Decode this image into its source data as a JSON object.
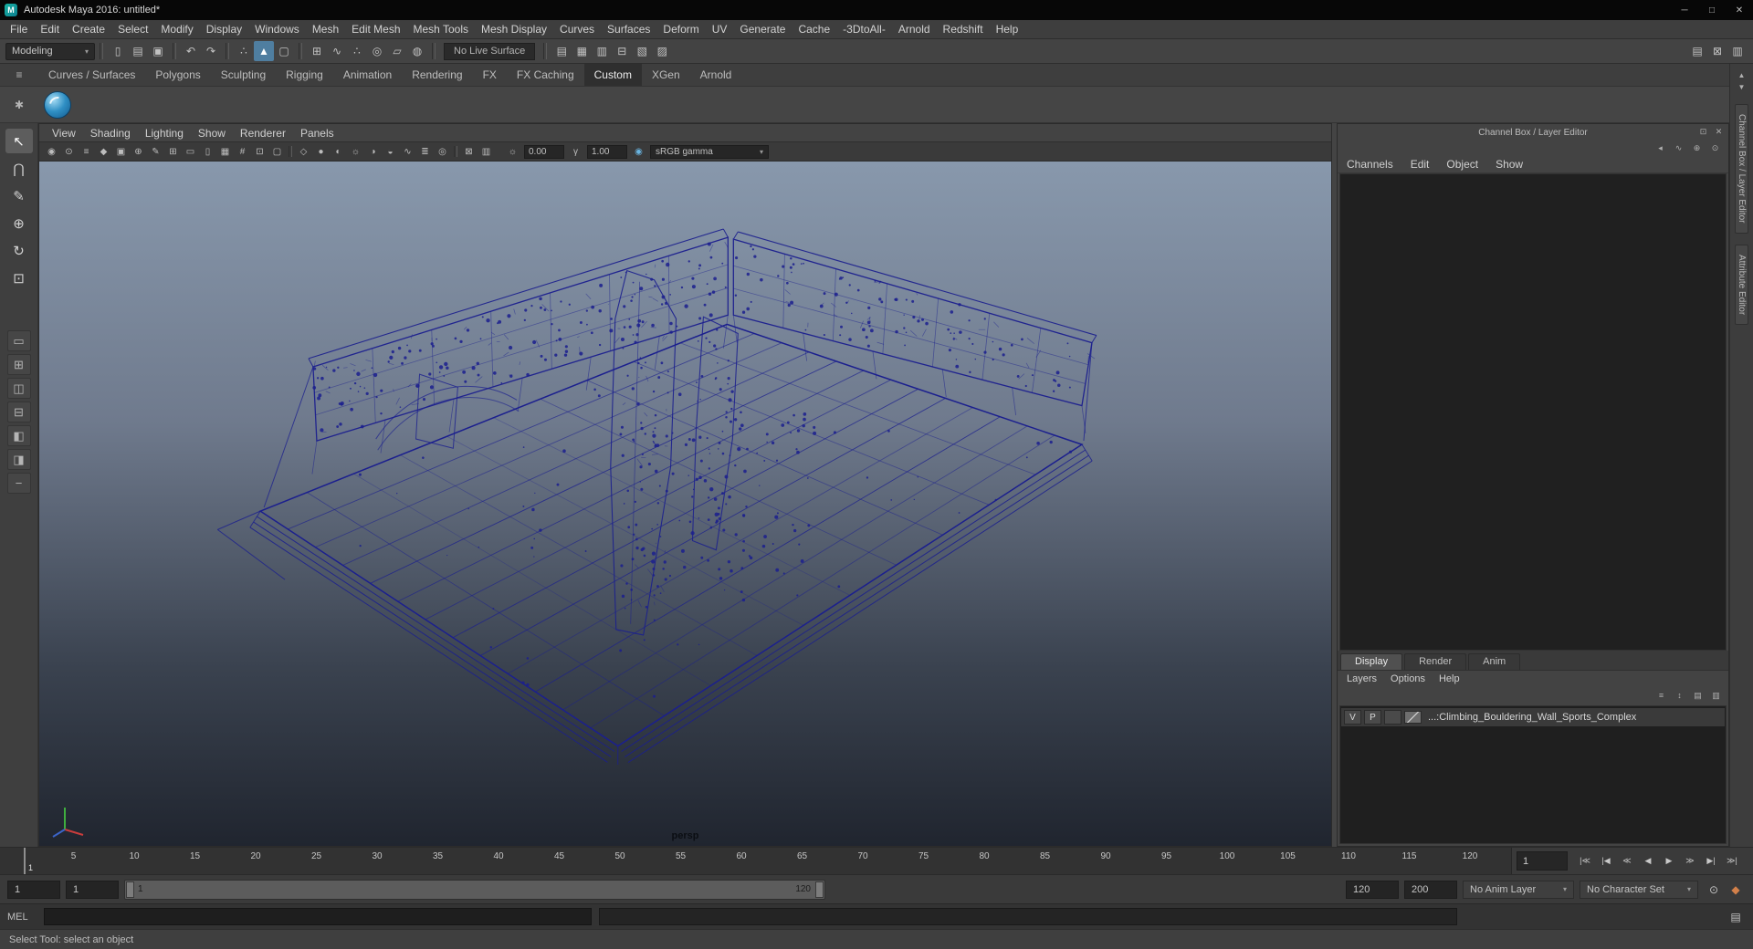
{
  "ui": {
    "chevron_down": "▾",
    "hamburger": "≡",
    "gear": "✱"
  },
  "colors": {
    "accent_blue": "#4f7ea0",
    "wireframe": "#1b1f8e",
    "viewport_top": "#8898ac",
    "viewport_bottom": "#20252f"
  },
  "titlebar": {
    "icon": "M",
    "title": "Autodesk Maya 2016: untitled*",
    "controls": [
      {
        "name": "minimize-button",
        "glyph": "─"
      },
      {
        "name": "maximize-button",
        "glyph": "□"
      },
      {
        "name": "close-button",
        "glyph": "✕"
      }
    ]
  },
  "menubar": {
    "items": [
      "File",
      "Edit",
      "Create",
      "Select",
      "Modify",
      "Display",
      "Windows",
      "Mesh",
      "Edit Mesh",
      "Mesh Tools",
      "Mesh Display",
      "Curves",
      "Surfaces",
      "Deform",
      "UV",
      "Generate",
      "Cache",
      "-3DtoAll-",
      "Arnold",
      "Redshift",
      "Help"
    ]
  },
  "statusline": {
    "menuset": "Modeling",
    "groups": [
      {
        "name": "scene",
        "icons": [
          {
            "name": "new-scene-icon",
            "glyph": "▯"
          },
          {
            "name": "open-scene-icon",
            "glyph": "▤"
          },
          {
            "name": "save-scene-icon",
            "glyph": "▣"
          }
        ]
      },
      {
        "name": "undo-redo",
        "icons": [
          {
            "name": "undo-icon",
            "glyph": "↶"
          },
          {
            "name": "redo-icon",
            "glyph": "↷"
          }
        ]
      },
      {
        "name": "selection-mode",
        "icons": [
          {
            "name": "select-hierarchy-icon",
            "glyph": "∴"
          },
          {
            "name": "select-object-icon",
            "glyph": "▲",
            "active": true
          },
          {
            "name": "select-component-icon",
            "glyph": "▢"
          }
        ]
      },
      {
        "name": "snapping",
        "icons": [
          {
            "name": "snap-to-grid-icon",
            "glyph": "⊞"
          },
          {
            "name": "snap-to-curves-icon",
            "glyph": "∿"
          },
          {
            "name": "snap-to-points-icon",
            "glyph": "∴"
          },
          {
            "name": "snap-to-projected-center-icon",
            "glyph": "◎"
          },
          {
            "name": "snap-to-view-planes-icon",
            "glyph": "▱"
          },
          {
            "name": "make-live-icon",
            "glyph": "◍"
          }
        ]
      }
    ],
    "live_surface": "No Live Surface",
    "render_group": [
      {
        "name": "render-view-icon",
        "glyph": "▤"
      },
      {
        "name": "render-current-frame-icon",
        "glyph": "▦"
      },
      {
        "name": "ipr-render-icon",
        "glyph": "▥"
      },
      {
        "name": "render-settings-icon",
        "glyph": "⊟"
      },
      {
        "name": "hypershade-icon",
        "glyph": "▧"
      },
      {
        "name": "light-editor-icon",
        "glyph": "▨"
      }
    ],
    "right_icons": [
      {
        "name": "sidebar-attribute-editor-icon",
        "glyph": "▤"
      },
      {
        "name": "sidebar-tool-settings-icon",
        "glyph": "⊠"
      },
      {
        "name": "sidebar-channel-box-icon",
        "glyph": "▥"
      }
    ]
  },
  "shelf": {
    "tabs": [
      "Curves / Surfaces",
      "Polygons",
      "Sculpting",
      "Rigging",
      "Animation",
      "Rendering",
      "FX",
      "FX Caching",
      "Custom",
      "XGen",
      "Arnold"
    ],
    "active_tab": "Custom"
  },
  "toolbox": {
    "tools": [
      {
        "name": "select-tool",
        "glyph": "↖"
      },
      {
        "name": "lasso-tool",
        "glyph": "⋂"
      },
      {
        "name": "paint-select-tool",
        "glyph": "✎"
      },
      {
        "name": "move-tool",
        "glyph": "⊕"
      },
      {
        "name": "rotate-tool",
        "glyph": "↻"
      },
      {
        "name": "scale-tool",
        "glyph": "⊡"
      }
    ],
    "layouts": [
      {
        "name": "single-pane-layout",
        "glyph": "▭"
      },
      {
        "name": "four-pane-layout",
        "glyph": "⊞"
      },
      {
        "name": "side-by-side-layout",
        "glyph": "◫"
      },
      {
        "name": "stacked-layout",
        "glyph": "⊟"
      },
      {
        "name": "three-pane-left-layout",
        "glyph": "◧"
      },
      {
        "name": "outliner-persp-layout",
        "glyph": "◨"
      }
    ],
    "collapse": "−"
  },
  "panel_menu": {
    "items": [
      "View",
      "Shading",
      "Lighting",
      "Show",
      "Renderer",
      "Panels"
    ]
  },
  "viewport_toolbar": {
    "groups": [
      [
        {
          "name": "select-camera-icon",
          "glyph": "◉"
        },
        {
          "name": "lock-camera-icon",
          "glyph": "⊙"
        },
        {
          "name": "camera-attributes-icon",
          "glyph": "≡"
        },
        {
          "name": "bookmarks-icon",
          "glyph": "◆"
        },
        {
          "name": "image-plane-icon",
          "glyph": "▣"
        },
        {
          "name": "two-d-pan-zoom-icon",
          "glyph": "⊕"
        },
        {
          "name": "grease-pencil-icon",
          "glyph": "✎"
        },
        {
          "name": "grid-icon",
          "glyph": "⊞"
        },
        {
          "name": "film-gate-icon",
          "glyph": "▭"
        },
        {
          "name": "resolution-gate-icon",
          "glyph": "▯"
        },
        {
          "name": "gate-mask-icon",
          "glyph": "▦"
        },
        {
          "name": "field-chart-icon",
          "glyph": "#"
        },
        {
          "name": "safe-action-icon",
          "glyph": "⊡"
        },
        {
          "name": "safe-title-icon",
          "glyph": "▢"
        }
      ],
      [
        {
          "name": "wireframe-icon",
          "glyph": "◇"
        },
        {
          "name": "smooth-shade-icon",
          "glyph": "●"
        },
        {
          "name": "textured-icon",
          "glyph": "◐"
        },
        {
          "name": "use-all-lights-icon",
          "glyph": "☼"
        },
        {
          "name": "shadows-icon",
          "glyph": "◑"
        },
        {
          "name": "screen-space-ao-icon",
          "glyph": "◒"
        },
        {
          "name": "motion-blur-icon",
          "glyph": "∿"
        },
        {
          "name": "multisampling-icon",
          "glyph": "≣"
        },
        {
          "name": "depth-of-field-icon",
          "glyph": "◎"
        }
      ],
      [
        {
          "name": "isolate-select-icon",
          "glyph": "⊠"
        },
        {
          "name": "x-ray-icon",
          "glyph": "▥"
        }
      ]
    ],
    "exposure_icon": {
      "glyph": "☼"
    },
    "exposure": "0.00",
    "gamma_icon": {
      "glyph": "γ"
    },
    "gamma": "1.00",
    "color_mgmt_icon": {
      "glyph": "◉"
    },
    "view_transform": "sRGB gamma"
  },
  "viewport": {
    "camera_label": "persp"
  },
  "channel_box": {
    "header": "Channel Box / Layer Editor",
    "header_icons": [
      {
        "name": "dock-icon",
        "glyph": "⊡"
      },
      {
        "name": "close-icon",
        "glyph": "✕"
      }
    ],
    "toolbar_icons": [
      {
        "name": "collapse-left-icon",
        "glyph": "◂"
      },
      {
        "name": "slider-speed-icon",
        "glyph": "∿"
      },
      {
        "name": "manipulator-icon",
        "glyph": "⊕"
      },
      {
        "name": "channel-settings-icon",
        "glyph": "⊙"
      }
    ],
    "menu": [
      "Channels",
      "Edit",
      "Object",
      "Show"
    ]
  },
  "layer_editor": {
    "tabs": [
      {
        "label": "Display",
        "active": true
      },
      {
        "label": "Render",
        "active": false
      },
      {
        "label": "Anim",
        "active": false
      }
    ],
    "menu": [
      "Layers",
      "Options",
      "Help"
    ],
    "toolbar_icons": [
      {
        "name": "sort-layers-icon",
        "glyph": "≡"
      },
      {
        "name": "move-layer-icon",
        "glyph": "↕"
      },
      {
        "name": "new-empty-layer-icon",
        "glyph": "▤"
      },
      {
        "name": "new-layer-from-selected-icon",
        "glyph": "▥"
      }
    ],
    "layer": {
      "visibility": "V",
      "playback": "P",
      "name": "...:Climbing_Bouldering_Wall_Sports_Complex"
    }
  },
  "side_tabs": {
    "scroll_up": "▲",
    "scroll_down": "▼",
    "tabs": [
      "Channel Box / Layer Editor",
      "Attribute Editor"
    ]
  },
  "timeline": {
    "ticks": [
      "5",
      "10",
      "15",
      "20",
      "25",
      "30",
      "35",
      "40",
      "45",
      "50",
      "55",
      "60",
      "65",
      "70",
      "75",
      "80",
      "85",
      "90",
      "95",
      "100",
      "105",
      "110",
      "115",
      "120"
    ],
    "marker_label": "1"
  },
  "playback": {
    "current_frame": "1",
    "buttons": [
      {
        "name": "go-to-start-button",
        "glyph": "|≪"
      },
      {
        "name": "step-back-frame-button",
        "glyph": "|◀"
      },
      {
        "name": "step-back-key-button",
        "glyph": "≪"
      },
      {
        "name": "play-backwards-button",
        "glyph": "◀"
      },
      {
        "name": "play-forwards-button",
        "glyph": "▶"
      },
      {
        "name": "step-forward-key-button",
        "glyph": "≫"
      },
      {
        "name": "step-forward-frame-button",
        "glyph": "▶|"
      },
      {
        "name": "go-to-end-button",
        "glyph": "≫|"
      }
    ]
  },
  "range_slider": {
    "anim_start": "1",
    "playback_start": "1",
    "bar_start": "1",
    "bar_end": "120",
    "playback_end": "120",
    "anim_end": "200",
    "anim_layer": "No Anim Layer",
    "character_set": "No Character Set",
    "icons": [
      {
        "name": "animation-key-settings-icon",
        "glyph": "⊙"
      },
      {
        "name": "auto-keyframe-toggle-icon",
        "glyph": "◆",
        "color": "#d2804a"
      }
    ]
  },
  "command_line": {
    "label": "MEL",
    "icon": {
      "name": "script-editor-icon",
      "glyph": "▤"
    }
  },
  "help_line": {
    "text": "Select Tool: select an object"
  }
}
